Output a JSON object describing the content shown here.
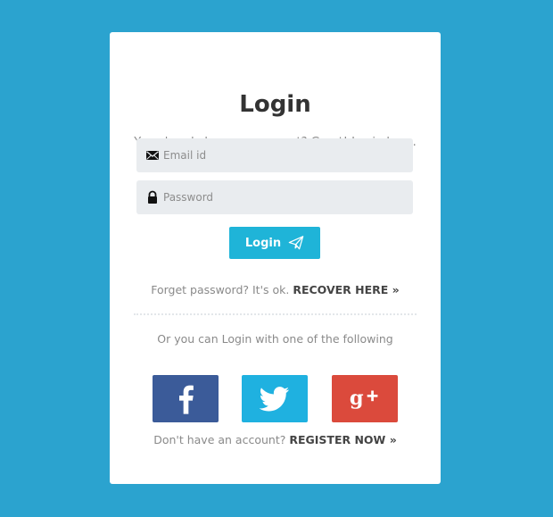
{
  "colors": {
    "background": "#2ba3cf",
    "card": "#ffffff",
    "primary_button": "#1fb4d8",
    "facebook": "#3b5b99",
    "twitter": "#1fb1e0",
    "google_plus": "#db4a3c"
  },
  "login": {
    "title": "Login",
    "subtitle": "You already have an account? Great! Login here.",
    "email": {
      "placeholder": "Email id",
      "value": "",
      "icon": "envelope-icon"
    },
    "password": {
      "placeholder": "Password",
      "value": "",
      "icon": "lock-icon"
    },
    "submit_label": "Login",
    "submit_icon": "paper-plane-icon"
  },
  "forgot": {
    "text": "Forget password? It's ok.",
    "link": "RECOVER HERE »"
  },
  "social": {
    "heading": "Or you can Login with one of the following",
    "buttons": [
      {
        "name": "facebook",
        "icon": "facebook-icon"
      },
      {
        "name": "twitter",
        "icon": "twitter-icon"
      },
      {
        "name": "google-plus",
        "icon": "google-plus-icon"
      }
    ]
  },
  "register": {
    "text": "Don't have an account?",
    "link": "REGISTER NOW »"
  }
}
